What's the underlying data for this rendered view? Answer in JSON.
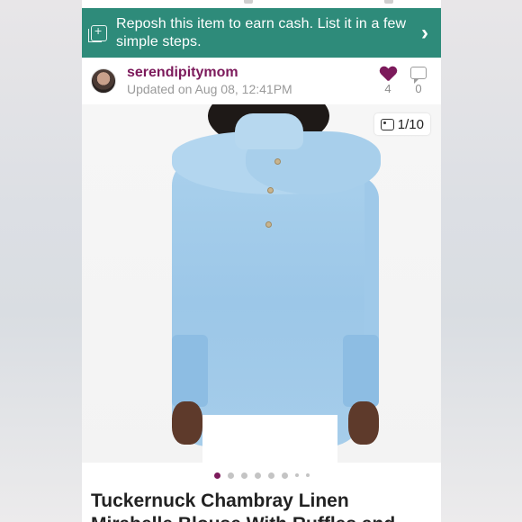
{
  "banner": {
    "text": "Reposh this item to earn cash. List it in a few simple steps.",
    "icon": "repost-icon",
    "chevron": "›",
    "color": "#2e8b7a"
  },
  "seller": {
    "name": "serendipitymom",
    "updated": "Updated on Aug 08, 12:41PM",
    "likes": "4",
    "comments": "0"
  },
  "photo": {
    "counter": "1/10",
    "dots": 8,
    "active_index": 0
  },
  "listing": {
    "title": "Tuckernuck Chambray Linen Mirabelle Blouse With Ruffles and"
  },
  "colors": {
    "accent": "#7c1a5b",
    "banner": "#2e8b7a"
  }
}
